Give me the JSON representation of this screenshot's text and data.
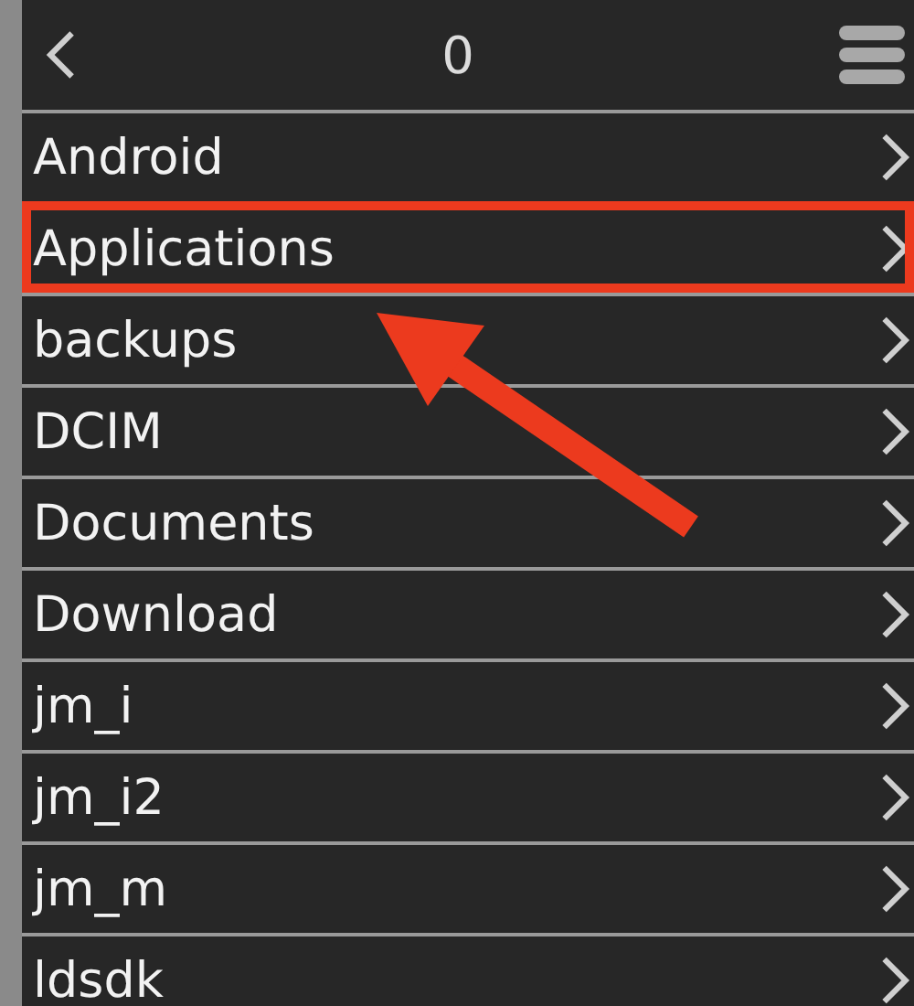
{
  "header": {
    "title": "0"
  },
  "folders": [
    {
      "name": "Android",
      "highlighted": false
    },
    {
      "name": "Applications",
      "highlighted": true
    },
    {
      "name": "backups",
      "highlighted": false
    },
    {
      "name": "DCIM",
      "highlighted": false
    },
    {
      "name": "Documents",
      "highlighted": false
    },
    {
      "name": "Download",
      "highlighted": false
    },
    {
      "name": "jm_i",
      "highlighted": false
    },
    {
      "name": "jm_i2",
      "highlighted": false
    },
    {
      "name": "jm_m",
      "highlighted": false
    },
    {
      "name": "ldsdk",
      "highlighted": false
    }
  ]
}
